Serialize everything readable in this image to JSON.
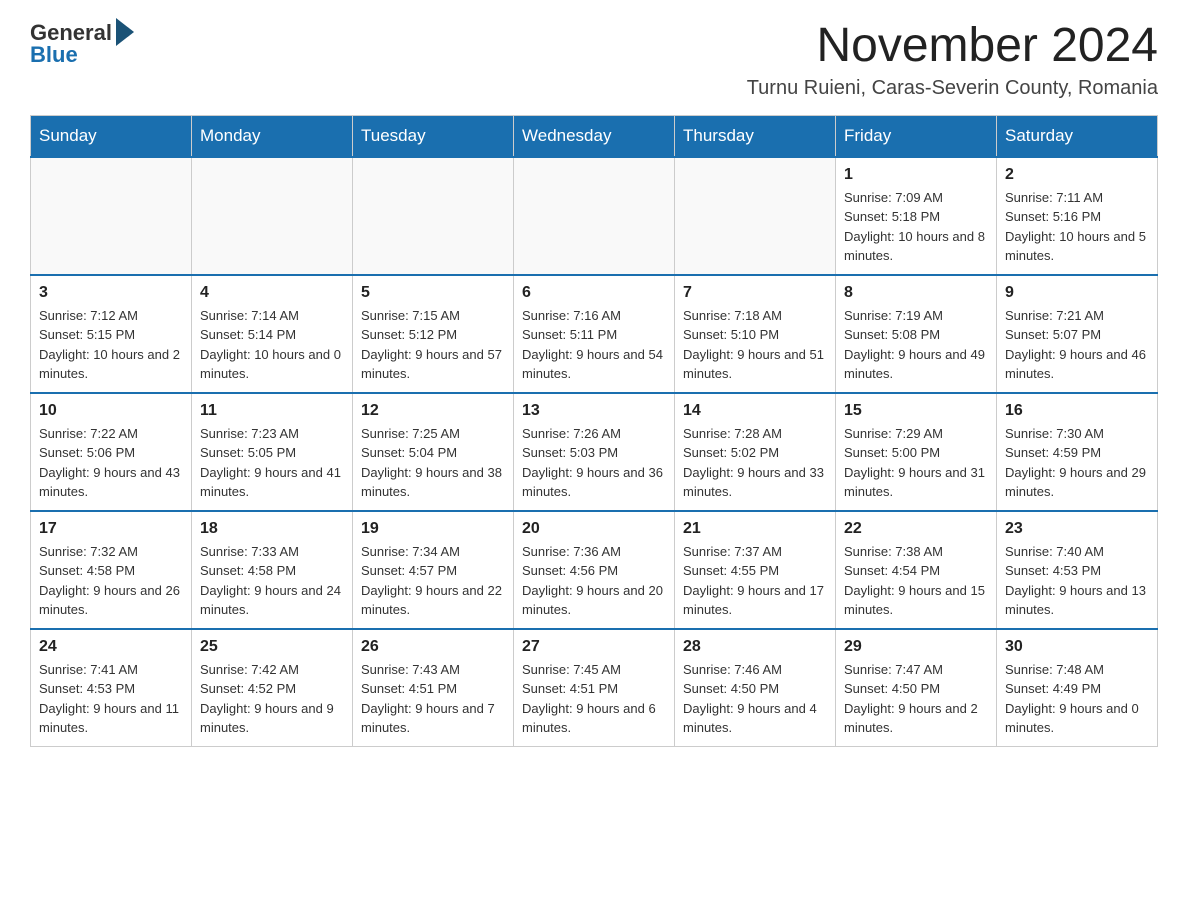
{
  "logo": {
    "general": "General",
    "blue": "Blue"
  },
  "header": {
    "month_year": "November 2024",
    "location": "Turnu Ruieni, Caras-Severin County, Romania"
  },
  "weekdays": [
    "Sunday",
    "Monday",
    "Tuesday",
    "Wednesday",
    "Thursday",
    "Friday",
    "Saturday"
  ],
  "weeks": [
    [
      {
        "day": "",
        "info": ""
      },
      {
        "day": "",
        "info": ""
      },
      {
        "day": "",
        "info": ""
      },
      {
        "day": "",
        "info": ""
      },
      {
        "day": "",
        "info": ""
      },
      {
        "day": "1",
        "info": "Sunrise: 7:09 AM\nSunset: 5:18 PM\nDaylight: 10 hours and 8 minutes."
      },
      {
        "day": "2",
        "info": "Sunrise: 7:11 AM\nSunset: 5:16 PM\nDaylight: 10 hours and 5 minutes."
      }
    ],
    [
      {
        "day": "3",
        "info": "Sunrise: 7:12 AM\nSunset: 5:15 PM\nDaylight: 10 hours and 2 minutes."
      },
      {
        "day": "4",
        "info": "Sunrise: 7:14 AM\nSunset: 5:14 PM\nDaylight: 10 hours and 0 minutes."
      },
      {
        "day": "5",
        "info": "Sunrise: 7:15 AM\nSunset: 5:12 PM\nDaylight: 9 hours and 57 minutes."
      },
      {
        "day": "6",
        "info": "Sunrise: 7:16 AM\nSunset: 5:11 PM\nDaylight: 9 hours and 54 minutes."
      },
      {
        "day": "7",
        "info": "Sunrise: 7:18 AM\nSunset: 5:10 PM\nDaylight: 9 hours and 51 minutes."
      },
      {
        "day": "8",
        "info": "Sunrise: 7:19 AM\nSunset: 5:08 PM\nDaylight: 9 hours and 49 minutes."
      },
      {
        "day": "9",
        "info": "Sunrise: 7:21 AM\nSunset: 5:07 PM\nDaylight: 9 hours and 46 minutes."
      }
    ],
    [
      {
        "day": "10",
        "info": "Sunrise: 7:22 AM\nSunset: 5:06 PM\nDaylight: 9 hours and 43 minutes."
      },
      {
        "day": "11",
        "info": "Sunrise: 7:23 AM\nSunset: 5:05 PM\nDaylight: 9 hours and 41 minutes."
      },
      {
        "day": "12",
        "info": "Sunrise: 7:25 AM\nSunset: 5:04 PM\nDaylight: 9 hours and 38 minutes."
      },
      {
        "day": "13",
        "info": "Sunrise: 7:26 AM\nSunset: 5:03 PM\nDaylight: 9 hours and 36 minutes."
      },
      {
        "day": "14",
        "info": "Sunrise: 7:28 AM\nSunset: 5:02 PM\nDaylight: 9 hours and 33 minutes."
      },
      {
        "day": "15",
        "info": "Sunrise: 7:29 AM\nSunset: 5:00 PM\nDaylight: 9 hours and 31 minutes."
      },
      {
        "day": "16",
        "info": "Sunrise: 7:30 AM\nSunset: 4:59 PM\nDaylight: 9 hours and 29 minutes."
      }
    ],
    [
      {
        "day": "17",
        "info": "Sunrise: 7:32 AM\nSunset: 4:58 PM\nDaylight: 9 hours and 26 minutes."
      },
      {
        "day": "18",
        "info": "Sunrise: 7:33 AM\nSunset: 4:58 PM\nDaylight: 9 hours and 24 minutes."
      },
      {
        "day": "19",
        "info": "Sunrise: 7:34 AM\nSunset: 4:57 PM\nDaylight: 9 hours and 22 minutes."
      },
      {
        "day": "20",
        "info": "Sunrise: 7:36 AM\nSunset: 4:56 PM\nDaylight: 9 hours and 20 minutes."
      },
      {
        "day": "21",
        "info": "Sunrise: 7:37 AM\nSunset: 4:55 PM\nDaylight: 9 hours and 17 minutes."
      },
      {
        "day": "22",
        "info": "Sunrise: 7:38 AM\nSunset: 4:54 PM\nDaylight: 9 hours and 15 minutes."
      },
      {
        "day": "23",
        "info": "Sunrise: 7:40 AM\nSunset: 4:53 PM\nDaylight: 9 hours and 13 minutes."
      }
    ],
    [
      {
        "day": "24",
        "info": "Sunrise: 7:41 AM\nSunset: 4:53 PM\nDaylight: 9 hours and 11 minutes."
      },
      {
        "day": "25",
        "info": "Sunrise: 7:42 AM\nSunset: 4:52 PM\nDaylight: 9 hours and 9 minutes."
      },
      {
        "day": "26",
        "info": "Sunrise: 7:43 AM\nSunset: 4:51 PM\nDaylight: 9 hours and 7 minutes."
      },
      {
        "day": "27",
        "info": "Sunrise: 7:45 AM\nSunset: 4:51 PM\nDaylight: 9 hours and 6 minutes."
      },
      {
        "day": "28",
        "info": "Sunrise: 7:46 AM\nSunset: 4:50 PM\nDaylight: 9 hours and 4 minutes."
      },
      {
        "day": "29",
        "info": "Sunrise: 7:47 AM\nSunset: 4:50 PM\nDaylight: 9 hours and 2 minutes."
      },
      {
        "day": "30",
        "info": "Sunrise: 7:48 AM\nSunset: 4:49 PM\nDaylight: 9 hours and 0 minutes."
      }
    ]
  ]
}
